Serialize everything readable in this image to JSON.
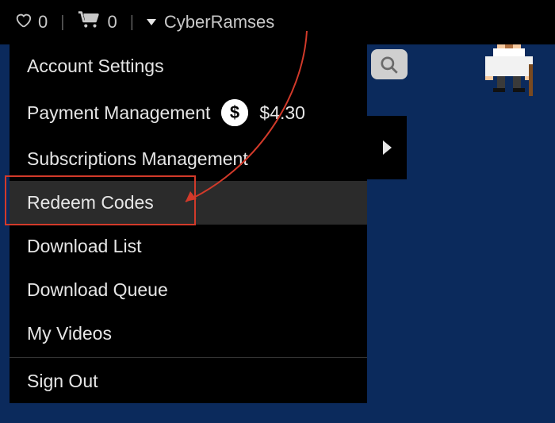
{
  "topbar": {
    "wishlist_count": "0",
    "cart_count": "0",
    "username": "CyberRamses"
  },
  "dropdown": {
    "items": [
      {
        "key": "account-settings",
        "label": "Account Settings",
        "highlight": false
      },
      {
        "key": "payment-management",
        "label": "Payment Management",
        "highlight": false,
        "has_balance": true,
        "balance": "$4.30"
      },
      {
        "key": "subscriptions-management",
        "label": "Subscriptions Management",
        "highlight": false
      },
      {
        "key": "redeem-codes",
        "label": "Redeem Codes",
        "highlight": true
      },
      {
        "key": "download-list",
        "label": "Download List",
        "highlight": false
      },
      {
        "key": "download-queue",
        "label": "Download Queue",
        "highlight": false
      },
      {
        "key": "my-videos",
        "label": "My Videos",
        "highlight": false
      }
    ],
    "sign_out_label": "Sign Out",
    "balance": "$4.30"
  },
  "colors": {
    "accent": "#d23a2a",
    "plus": "#d8a227",
    "bg_deep": "#0b2a5c"
  }
}
